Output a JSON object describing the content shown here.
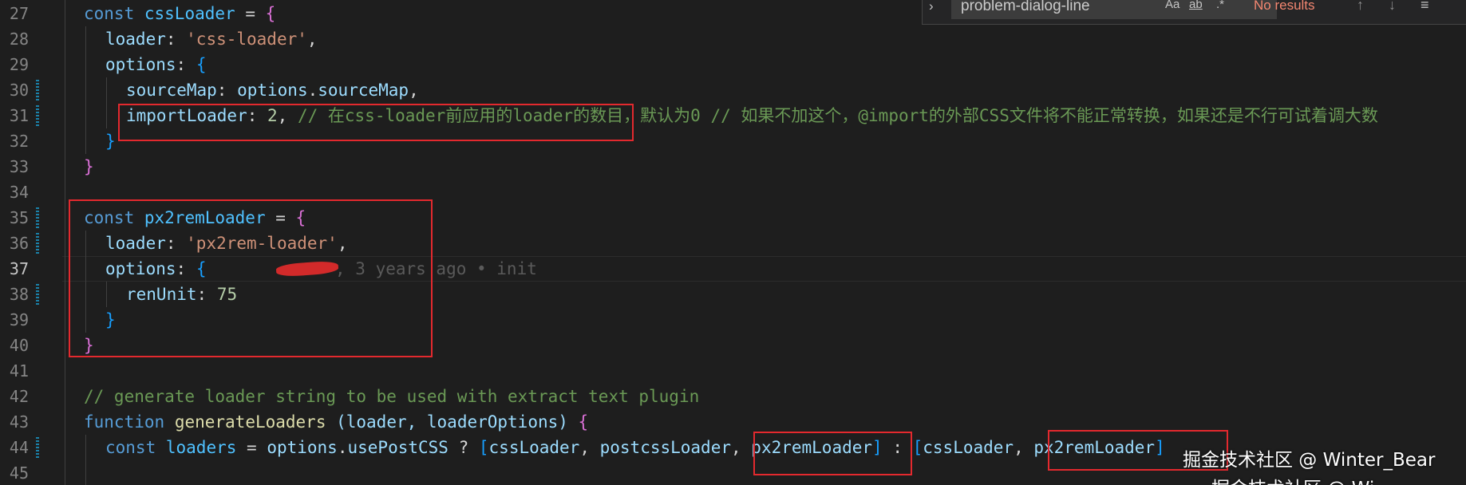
{
  "find_widget": {
    "query": "problem-dialog-line",
    "match_case_label": "Aa",
    "whole_word_label": "ab",
    "regex_label": ".*",
    "results": "No results"
  },
  "line_numbers": [
    "27",
    "28",
    "29",
    "30",
    "31",
    "32",
    "33",
    "34",
    "35",
    "36",
    "37",
    "38",
    "39",
    "40",
    "41",
    "42",
    "43",
    "44",
    "45"
  ],
  "code": {
    "l27": {
      "kw": "const",
      "name": "cssLoader",
      "eq": " = ",
      "br": "{"
    },
    "l28": {
      "prop": "loader",
      "str": "'css-loader'"
    },
    "l29": {
      "prop": "options",
      "br": "{"
    },
    "l30": {
      "prop": "sourceMap",
      "obj": "options",
      "objprop": "sourceMap"
    },
    "l31": {
      "prop": "importLoader",
      "num": "2",
      "comment": "// 在css-loader前应用的loader的数目，默认为0 // 如果不加这个，@import的外部CSS文件将不能正常转换，如果还是不行可试着调大数"
    },
    "l32": {
      "br": "}"
    },
    "l33": {
      "br": "}"
    },
    "l35": {
      "kw": "const",
      "name": "px2remLoader",
      "eq": " = ",
      "br": "{"
    },
    "l36": {
      "prop": "loader",
      "str": "'px2rem-loader'"
    },
    "l37": {
      "prop": "options",
      "br": "{",
      "blame": ", 3 years ago • init"
    },
    "l38": {
      "prop": "renUnit",
      "num": "75"
    },
    "l39": {
      "br": "}"
    },
    "l40": {
      "br": "}"
    },
    "l42": {
      "comment": "// generate loader string to be used with extract text plugin"
    },
    "l43": {
      "kw": "function",
      "fn": "generateLoaders",
      "params": " (loader, loaderOptions) ",
      "br": "{"
    },
    "l44": {
      "kw": "const",
      "name": "loaders",
      "obj": "options",
      "objprop": "usePostCSS",
      "a1": "cssLoader",
      "a2": "postcssLoader",
      "a3": "px2remLoader",
      "b1": "cssLoader",
      "b2": "px2remLoader"
    }
  },
  "watermark": "掘金技术社区 @ Winter_Bear",
  "watermark_partial": "掘金技术社区 @ Wi",
  "colors": {
    "background": "#1e1e1e",
    "keyword": "#569cd6",
    "property": "#9cdcfe",
    "string": "#ce9178",
    "number": "#b5cea8",
    "comment": "#6a9955",
    "annotation_box": "#e3292e"
  }
}
